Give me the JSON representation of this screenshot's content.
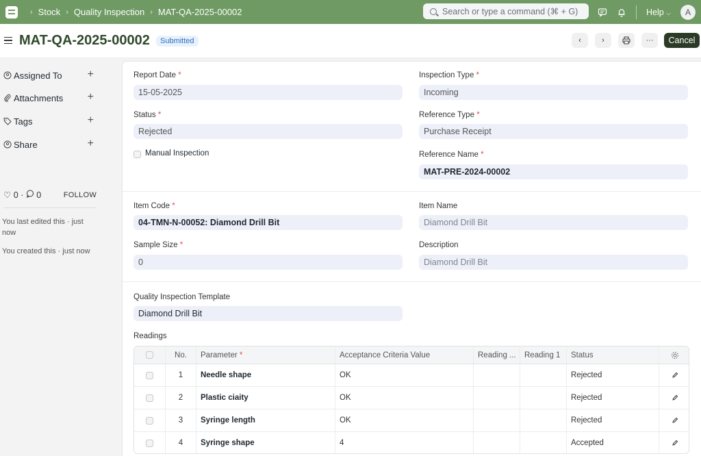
{
  "navbar": {
    "breadcrumbs": [
      "Stock",
      "Quality Inspection",
      "MAT-QA-2025-00002"
    ],
    "search_placeholder": "Search or type a command (⌘ + G)",
    "help_label": "Help",
    "avatar_initial": "A"
  },
  "page": {
    "title": "MAT-QA-2025-00002",
    "status_badge": "Submitted",
    "cancel_label": "Cancel",
    "more_label": "···"
  },
  "sidebar": {
    "items": [
      {
        "label": "Assigned To",
        "icon": "user-plus-icon"
      },
      {
        "label": "Attachments",
        "icon": "paperclip-icon"
      },
      {
        "label": "Tags",
        "icon": "tag-icon"
      },
      {
        "label": "Share",
        "icon": "share-icon"
      }
    ],
    "likes": "0",
    "comments": "0",
    "follow_label": "FOLLOW",
    "last_edited": "You last edited this · just now",
    "created": "You created this · just now"
  },
  "form": {
    "report_date_label": "Report Date",
    "report_date": "15-05-2025",
    "inspection_type_label": "Inspection Type",
    "inspection_type": "Incoming",
    "status_label": "Status",
    "status": "Rejected",
    "reference_type_label": "Reference Type",
    "reference_type": "Purchase Receipt",
    "manual_inspection_label": "Manual Inspection",
    "reference_name_label": "Reference Name",
    "reference_name": "MAT-PRE-2024-00002",
    "item_code_label": "Item Code",
    "item_code": "04-TMN-N-00052: Diamond Drill Bit",
    "item_name_label": "Item Name",
    "item_name": "Diamond Drill Bit",
    "sample_size_label": "Sample Size",
    "sample_size": "0",
    "description_label": "Description",
    "description": "Diamond Drill Bit",
    "template_label": "Quality Inspection Template",
    "template": "Diamond Drill Bit",
    "readings_label": "Readings"
  },
  "readings": {
    "columns": [
      "No.",
      "Parameter",
      "Acceptance Criteria Value",
      "Reading ...",
      "Reading 1",
      "Status"
    ],
    "rows": [
      {
        "no": "1",
        "parameter": "Needle shape",
        "criteria": "OK",
        "reading": "",
        "reading1": "",
        "status": "Rejected"
      },
      {
        "no": "2",
        "parameter": "Plastic ciaity",
        "criteria": "OK",
        "reading": "",
        "reading1": "",
        "status": "Rejected"
      },
      {
        "no": "3",
        "parameter": "Syringe length",
        "criteria": "OK",
        "reading": "",
        "reading1": "",
        "status": "Rejected"
      },
      {
        "no": "4",
        "parameter": "Syringe shape",
        "criteria": "4",
        "reading": "",
        "reading1": "",
        "status": "Accepted"
      }
    ]
  },
  "colors": {
    "navbar": "#6f9a63",
    "title": "#2e4a2a",
    "cancel_button": "#2b3a26",
    "badge_bg": "#e8f1fc",
    "badge_text": "#2c6fbf",
    "required": "#e24c4c"
  }
}
